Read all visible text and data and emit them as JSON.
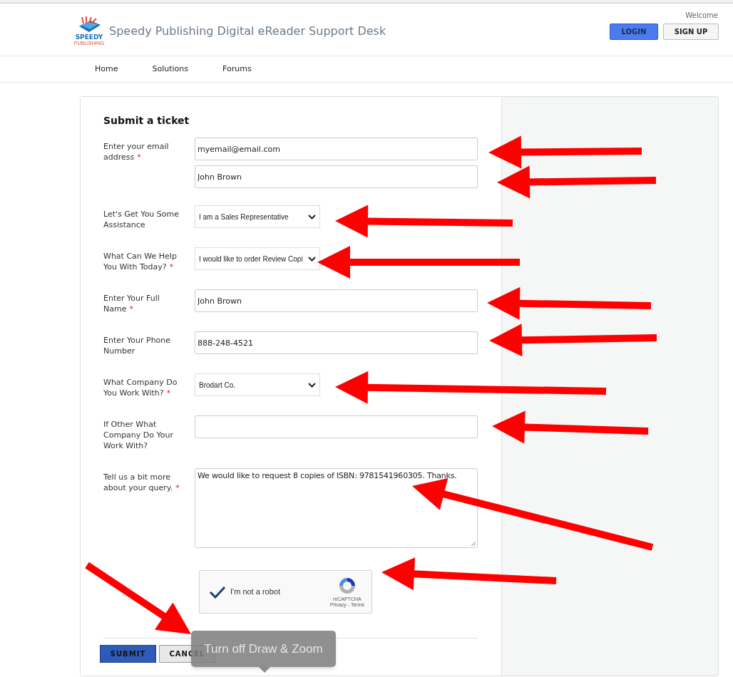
{
  "header": {
    "title": "Speedy Publishing Digital eReader Support Desk",
    "logo": {
      "word": "SPEEDY",
      "subword": "PUBLISHING"
    },
    "welcome": "Welcome",
    "buttons": [
      {
        "label": "LOGIN",
        "kind": "primary"
      },
      {
        "label": "SIGN UP",
        "kind": "secondary"
      }
    ]
  },
  "nav": [
    {
      "label": "Home"
    },
    {
      "label": "Solutions"
    },
    {
      "label": "Forums"
    }
  ],
  "form": {
    "title": "Submit a ticket",
    "required_mark": "*",
    "fields": [
      {
        "label": "Enter your email address",
        "required": true,
        "kind": "text",
        "inputs": [
          {
            "value": "myemail@email.com"
          },
          {
            "value": "John Brown"
          }
        ]
      },
      {
        "label": "Let's Get You Some Assistance",
        "required": false,
        "kind": "select",
        "value": "I am a Sales Representative"
      },
      {
        "label": "What Can We Help You With Today?",
        "required": true,
        "kind": "select",
        "value": "I would like to order Review Copi"
      },
      {
        "label": "Enter Your Full Name",
        "required": true,
        "kind": "text",
        "inputs": [
          {
            "value": "John Brown"
          }
        ]
      },
      {
        "label": "Enter Your Phone Number",
        "required": false,
        "kind": "text",
        "inputs": [
          {
            "value": "888-248-4521"
          }
        ]
      },
      {
        "label": "What Company Do You Work With?",
        "required": true,
        "kind": "select",
        "value": "Brodart Co."
      },
      {
        "label": "If Other What Company Do Your Work With?",
        "required": false,
        "kind": "text"
      },
      {
        "label": "Tell us a bit more about your query.",
        "required": true,
        "kind": "textarea",
        "value": "We would like to request 8 copies of ISBN: 9781541960305. Thanks."
      }
    ],
    "captcha": {
      "label": "I'm not a robot",
      "checked": true,
      "brand": "reCAPTCHA",
      "links": "Privacy - Terms"
    },
    "actions": [
      {
        "label": "SUBMIT",
        "kind": "primary"
      },
      {
        "label": "CANCEL",
        "kind": "secondary"
      }
    ]
  },
  "tooltip": "Turn off Draw & Zoom"
}
